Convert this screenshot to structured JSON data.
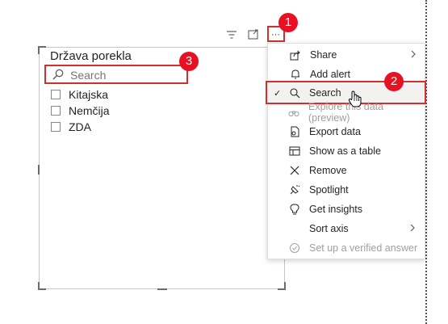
{
  "slicer": {
    "title": "Država porekla",
    "search_placeholder": "Search",
    "items": [
      {
        "label": "Kitajska"
      },
      {
        "label": "Nemčija"
      },
      {
        "label": "ZDA"
      }
    ]
  },
  "header_icons": [
    "filter-icon",
    "focus-mode-icon",
    "more-options-icon"
  ],
  "more_label": "···",
  "menu": {
    "items": [
      {
        "label": "Share",
        "icon": "share-icon",
        "has_submenu": true,
        "disabled": false,
        "checked": false
      },
      {
        "label": "Add alert",
        "icon": "bell-icon",
        "has_submenu": false,
        "disabled": false,
        "checked": false
      },
      {
        "label": "Search",
        "icon": "search-icon",
        "has_submenu": false,
        "disabled": false,
        "checked": true
      },
      {
        "label": "Explore this data (preview)",
        "icon": "binoculars-icon",
        "has_submenu": false,
        "disabled": true,
        "checked": false
      },
      {
        "label": "Export data",
        "icon": "export-icon",
        "has_submenu": false,
        "disabled": false,
        "checked": false
      },
      {
        "label": "Show as a table",
        "icon": "table-icon",
        "has_submenu": false,
        "disabled": false,
        "checked": false
      },
      {
        "label": "Remove",
        "icon": "close-icon",
        "has_submenu": false,
        "disabled": false,
        "checked": false
      },
      {
        "label": "Spotlight",
        "icon": "spotlight-icon",
        "has_submenu": false,
        "disabled": false,
        "checked": false
      },
      {
        "label": "Get insights",
        "icon": "lightbulb-icon",
        "has_submenu": false,
        "disabled": false,
        "checked": false
      },
      {
        "label": "Sort axis",
        "icon": "",
        "has_submenu": true,
        "disabled": false,
        "checked": false
      },
      {
        "label": "Set up a verified answer",
        "icon": "verified-icon",
        "has_submenu": false,
        "disabled": true,
        "checked": false
      }
    ]
  },
  "badges": [
    {
      "label": "1"
    },
    {
      "label": "2"
    },
    {
      "label": "3"
    }
  ],
  "colors": {
    "annotation_red": "#d32f2f",
    "badge_red": "#e81123",
    "disabled_text": "#a19f9d"
  }
}
